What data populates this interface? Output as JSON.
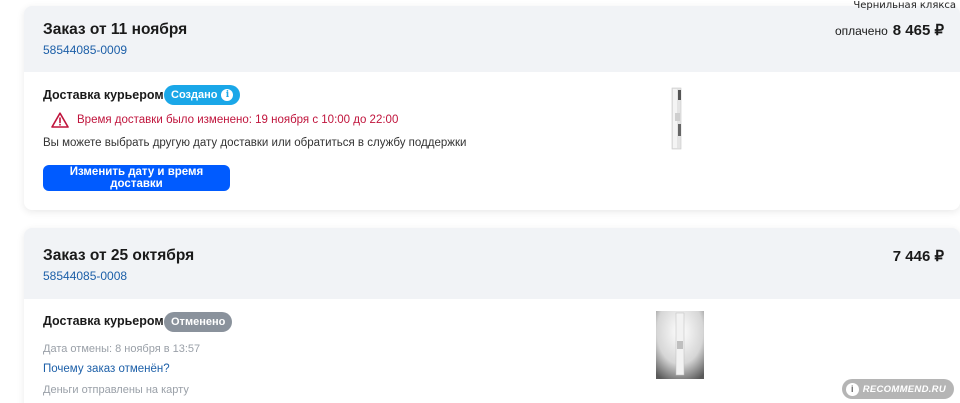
{
  "watermark_top": "Чернильная клякса",
  "watermark_bottom": {
    "text": "RECOMMEND.RU",
    "logo": "i"
  },
  "orders": [
    {
      "title": "Заказ от 11 ноября",
      "number": "58544085-0009",
      "paid_label": "оплачено",
      "price": "8 465 ₽",
      "delivery_title": "Доставка курьером",
      "status_badge": "Создано",
      "status_icon": "info-icon",
      "status_color": "#1aa7e8",
      "warning_icon": "warning-triangle-icon",
      "warning_text": "Время доставки было изменено: 19 ноября с 10:00 до 22:00",
      "hint_text": "Вы можете выбрать другую дату доставки или обратиться в службу поддержки",
      "action_button": "Изменить дату и время доставки",
      "accent_color": "#005bff"
    },
    {
      "title": "Заказ от 25 октября",
      "number": "58544085-0008",
      "price": "7 446 ₽",
      "delivery_title": "Доставка курьером",
      "status_badge": "Отменено",
      "status_color": "#8a929c",
      "cancel_date": "Дата отмены: 8 ноября в 13:57",
      "why_link": "Почему заказ отменён?",
      "refund_text": "Деньги отправлены на карту"
    }
  ]
}
